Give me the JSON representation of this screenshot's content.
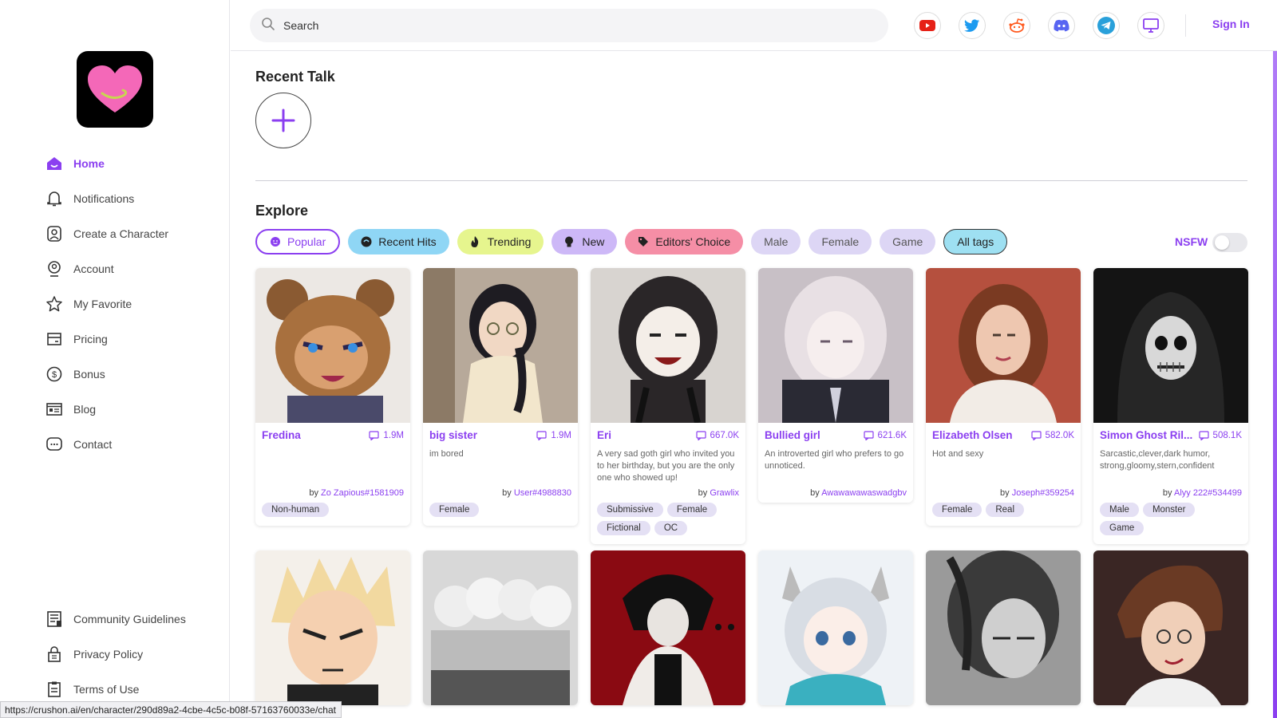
{
  "brand": {
    "logo_color": "#f468b8",
    "accent": "#8b3ff0"
  },
  "sidebar": {
    "items": [
      {
        "label": "Home",
        "icon": "home-icon",
        "active": true
      },
      {
        "label": "Notifications",
        "icon": "bell-icon"
      },
      {
        "label": "Create a Character",
        "icon": "create-character-icon"
      },
      {
        "label": "Account",
        "icon": "account-icon"
      },
      {
        "label": "My Favorite",
        "icon": "star-icon"
      },
      {
        "label": "Pricing",
        "icon": "pricing-icon"
      },
      {
        "label": "Bonus",
        "icon": "dollar-coin-icon"
      },
      {
        "label": "Blog",
        "icon": "blog-icon"
      },
      {
        "label": "Contact",
        "icon": "chat-bubble-icon"
      }
    ],
    "bottom": [
      {
        "label": "Community Guidelines",
        "icon": "guidelines-icon"
      },
      {
        "label": "Privacy Policy",
        "icon": "lock-icon"
      },
      {
        "label": "Terms of Use",
        "icon": "clipboard-icon"
      }
    ]
  },
  "topbar": {
    "search_placeholder": "Search",
    "socials": [
      "youtube-icon",
      "twitter-icon",
      "reddit-icon",
      "discord-icon",
      "telegram-icon",
      "desktop-icon"
    ],
    "signin": "Sign In"
  },
  "recent": {
    "title": "Recent Talk"
  },
  "explore": {
    "title": "Explore",
    "filters": [
      "Popular",
      "Recent Hits",
      "Trending",
      "New",
      "Editors' Choice",
      "Male",
      "Female",
      "Game",
      "All tags"
    ],
    "nsfw_label": "NSFW",
    "nsfw_on": false
  },
  "cards": [
    {
      "name": "Fredina",
      "count": "1.9M",
      "desc": "",
      "by_prefix": "by",
      "author": "Zo Zapious#1581909",
      "tags": [
        "Non-human"
      ]
    },
    {
      "name": "big sister",
      "count": "1.9M",
      "desc": "im bored",
      "by_prefix": "by",
      "author": "User#4988830",
      "tags": [
        "Female"
      ]
    },
    {
      "name": "Eri",
      "count": "667.0K",
      "desc": "A very sad goth girl who invited you to her birthday, but you are the only one who showed up!",
      "by_prefix": "by",
      "author": "Grawlix",
      "tags": [
        "Submissive",
        "Female",
        "Fictional",
        "OC"
      ]
    },
    {
      "name": "Bullied girl",
      "count": "621.6K",
      "desc": "An introverted girl who prefers to go unnoticed.",
      "by_prefix": "by",
      "author": "Awawawawaswadgbv",
      "tags": []
    },
    {
      "name": "Elizabeth Olsen",
      "count": "582.0K",
      "desc": "Hot and sexy",
      "by_prefix": "by",
      "author": "Joseph#359254",
      "tags": [
        "Female",
        "Real"
      ]
    },
    {
      "name": "Simon Ghost Ril...",
      "count": "508.1K",
      "desc": "Sarcastic,clever,dark humor, strong,gloomy,stern,confident",
      "by_prefix": "by",
      "author": "Alyy 222#534499",
      "tags": [
        "Male",
        "Monster",
        "Game"
      ]
    }
  ],
  "status_url": "https://crushon.ai/en/character/290d89a2-4cbe-4c5c-b08f-57163760033e/chat"
}
